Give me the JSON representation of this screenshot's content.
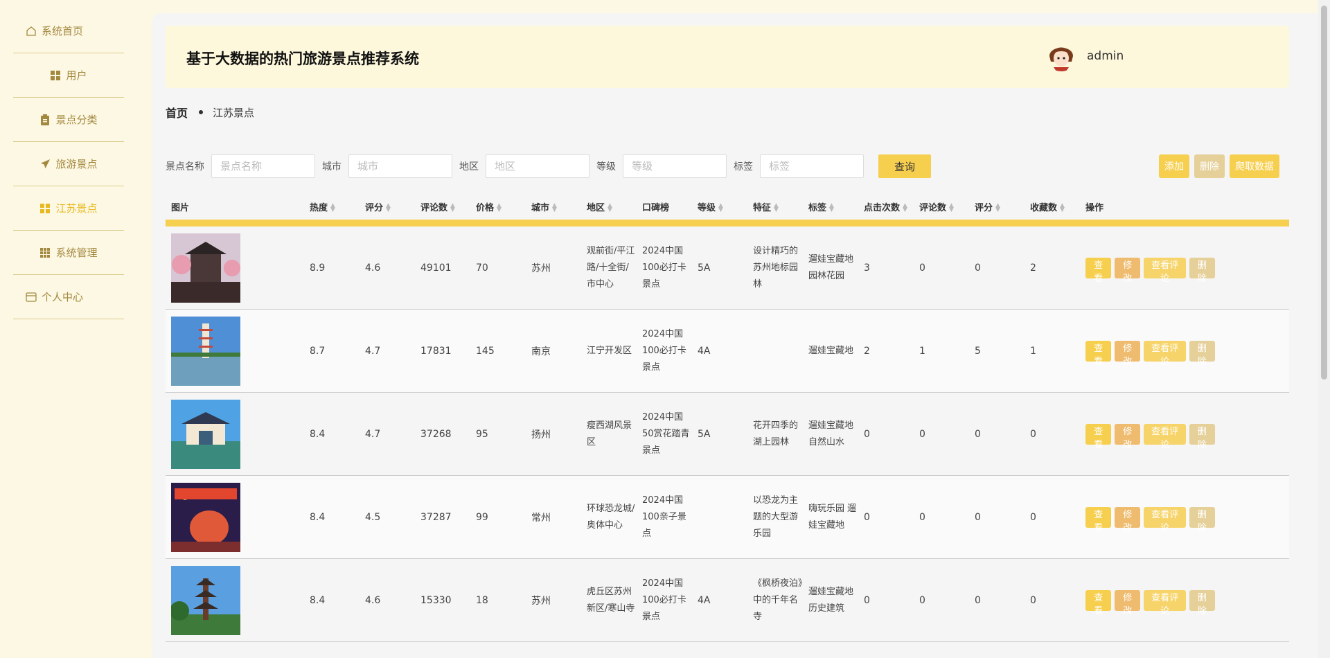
{
  "sidebar": {
    "items": [
      {
        "label": "系统首页",
        "icon": "home-icon"
      },
      {
        "label": "用户",
        "icon": "grid-icon"
      },
      {
        "label": "景点分类",
        "icon": "clipboard-icon"
      },
      {
        "label": "旅游景点",
        "icon": "send-icon"
      },
      {
        "label": "江苏景点",
        "icon": "grid-icon",
        "active": true
      },
      {
        "label": "系统管理",
        "icon": "grid-nine-icon"
      },
      {
        "label": "个人中心",
        "icon": "card-icon"
      }
    ]
  },
  "header": {
    "title": "基于大数据的热门旅游景点推荐系统",
    "username": "admin"
  },
  "breadcrumb": {
    "home": "首页",
    "current": "江苏景点"
  },
  "search": {
    "name_label": "景点名称",
    "name_placeholder": "景点名称",
    "city_label": "城市",
    "city_placeholder": "城市",
    "area_label": "地区",
    "area_placeholder": "地区",
    "level_label": "等级",
    "level_placeholder": "等级",
    "tag_label": "标签",
    "tag_placeholder": "标签",
    "query_label": "查询"
  },
  "actions": {
    "add": "添加",
    "delete": "删除",
    "crawl": "爬取数据"
  },
  "table": {
    "headers": [
      "图片",
      "热度",
      "评分",
      "评论数",
      "价格",
      "城市",
      "地区",
      "口碑榜",
      "等级",
      "特征",
      "标签",
      "点击次数",
      "评论数",
      "评分",
      "收藏数",
      "操作"
    ],
    "op_labels": {
      "view": "查看",
      "edit": "修改",
      "comments": "查看评论",
      "delete": "删除"
    },
    "rows": [
      {
        "heat": "8.9",
        "score": "4.6",
        "reviews": "49101",
        "price": "70",
        "city": "苏州",
        "area": "观前街/平江路/十全街/市中心",
        "rank": "2024中国100必打卡景点",
        "level": "5A",
        "feature": "设计精巧的苏州地标园林",
        "tag": "遛娃宝藏地 园林花园",
        "clicks": "3",
        "comments": "0",
        "rating": "0",
        "favs": "2"
      },
      {
        "heat": "8.7",
        "score": "4.7",
        "reviews": "17831",
        "price": "145",
        "city": "南京",
        "area": "江宁开发区",
        "rank": "2024中国100必打卡景点",
        "level": "4A",
        "feature": "",
        "tag": "遛娃宝藏地",
        "clicks": "2",
        "comments": "1",
        "rating": "5",
        "favs": "1"
      },
      {
        "heat": "8.4",
        "score": "4.7",
        "reviews": "37268",
        "price": "95",
        "city": "扬州",
        "area": "瘦西湖风景区",
        "rank": "2024中国50赏花踏青景点",
        "level": "5A",
        "feature": "花开四季的湖上园林",
        "tag": "遛娃宝藏地 自然山水",
        "clicks": "0",
        "comments": "0",
        "rating": "0",
        "favs": "0"
      },
      {
        "heat": "8.4",
        "score": "4.5",
        "reviews": "37287",
        "price": "99",
        "city": "常州",
        "area": "环球恐龙城/奥体中心",
        "rank": "2024中国100亲子景点",
        "level": "",
        "feature": "以恐龙为主题的大型游乐园",
        "tag": "嗨玩乐园 遛娃宝藏地",
        "clicks": "0",
        "comments": "0",
        "rating": "0",
        "favs": "0"
      },
      {
        "heat": "8.4",
        "score": "4.6",
        "reviews": "15330",
        "price": "18",
        "city": "苏州",
        "area": "虎丘区苏州新区/寒山寺",
        "rank": "2024中国100必打卡景点",
        "level": "4A",
        "feature": "《枫桥夜泊》中的千年名寺",
        "tag": "遛娃宝藏地 历史建筑",
        "clicks": "0",
        "comments": "0",
        "rating": "0",
        "favs": "0"
      }
    ]
  },
  "colors": {
    "accent": "#f7cf4f",
    "sidebar_text": "#a3893f",
    "active": "#e8b923",
    "edit": "#efbb6e",
    "del": "#e6d09a"
  }
}
